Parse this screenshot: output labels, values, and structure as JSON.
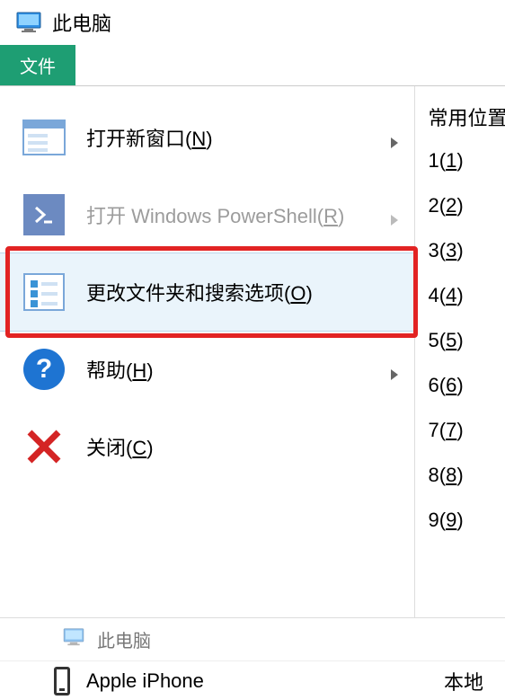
{
  "window": {
    "title": "此电脑"
  },
  "ribbon": {
    "tabs": [
      {
        "label": "文件",
        "active": true
      }
    ]
  },
  "file_menu": {
    "items": [
      {
        "label": "打开新窗口",
        "accel": "N",
        "icon": "new-window-icon",
        "submenu": true,
        "disabled": false
      },
      {
        "label": "打开 Windows PowerShell",
        "accel": "R",
        "icon": "powershell-icon",
        "submenu": true,
        "disabled": true
      },
      {
        "label": "更改文件夹和搜索选项",
        "accel": "O",
        "icon": "options-icon",
        "submenu": false,
        "disabled": false,
        "highlighted": true
      },
      {
        "label": "帮助",
        "accel": "H",
        "icon": "help-icon",
        "submenu": true,
        "disabled": false
      },
      {
        "label": "关闭",
        "accel": "C",
        "icon": "close-icon",
        "submenu": false,
        "disabled": false
      }
    ]
  },
  "frequent": {
    "header": "常用位置",
    "items": [
      {
        "num": "1",
        "accel": "1"
      },
      {
        "num": "2",
        "accel": "2"
      },
      {
        "num": "3",
        "accel": "3"
      },
      {
        "num": "4",
        "accel": "4"
      },
      {
        "num": "5",
        "accel": "5"
      },
      {
        "num": "6",
        "accel": "6"
      },
      {
        "num": "7",
        "accel": "7"
      },
      {
        "num": "8",
        "accel": "8"
      },
      {
        "num": "9",
        "accel": "9"
      }
    ]
  },
  "nav_tree": {
    "node": "此电脑"
  },
  "content": {
    "device": "Apple iPhone",
    "right_label": "本地"
  },
  "colors": {
    "ribbon_active": "#1e9e73",
    "highlight_bg": "#eaf4fb",
    "annotation_red": "#e22323"
  }
}
